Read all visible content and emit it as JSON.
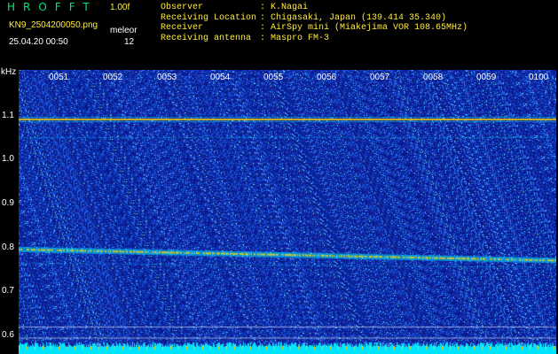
{
  "header": {
    "app_title": "HROFFT",
    "version": "1.00f",
    "filename": "KN9_2504200050.png",
    "meleor_label": "meleor",
    "meleor_count": "12",
    "datetime": "25.04.20 00:50",
    "info": [
      {
        "key": "Observer",
        "value": "K.Nagai"
      },
      {
        "key": "Receiving Location",
        "value": "Chigasaki, Japan (139.414 35.340)"
      },
      {
        "key": "Receiver",
        "value": "AirSpy mini (Miakejima VOR 108.65MHz)"
      },
      {
        "key": "Receiving antenna",
        "value": "Maspro FM-3"
      }
    ]
  },
  "spectrogram": {
    "y_unit": "kHz",
    "y_ticks": [
      "1.1",
      "1.0",
      "0.9",
      "0.8",
      "0.7",
      "0.6"
    ],
    "time_ticks": [
      "0051",
      "0052",
      "0053",
      "0054",
      "0055",
      "0056",
      "0057",
      "0058",
      "0059",
      "0100"
    ],
    "colors": {
      "background": "#0a1a8a",
      "noise": "#3a7cff",
      "carrier": "#ffd200",
      "baseline": "#00e5ff"
    }
  }
}
